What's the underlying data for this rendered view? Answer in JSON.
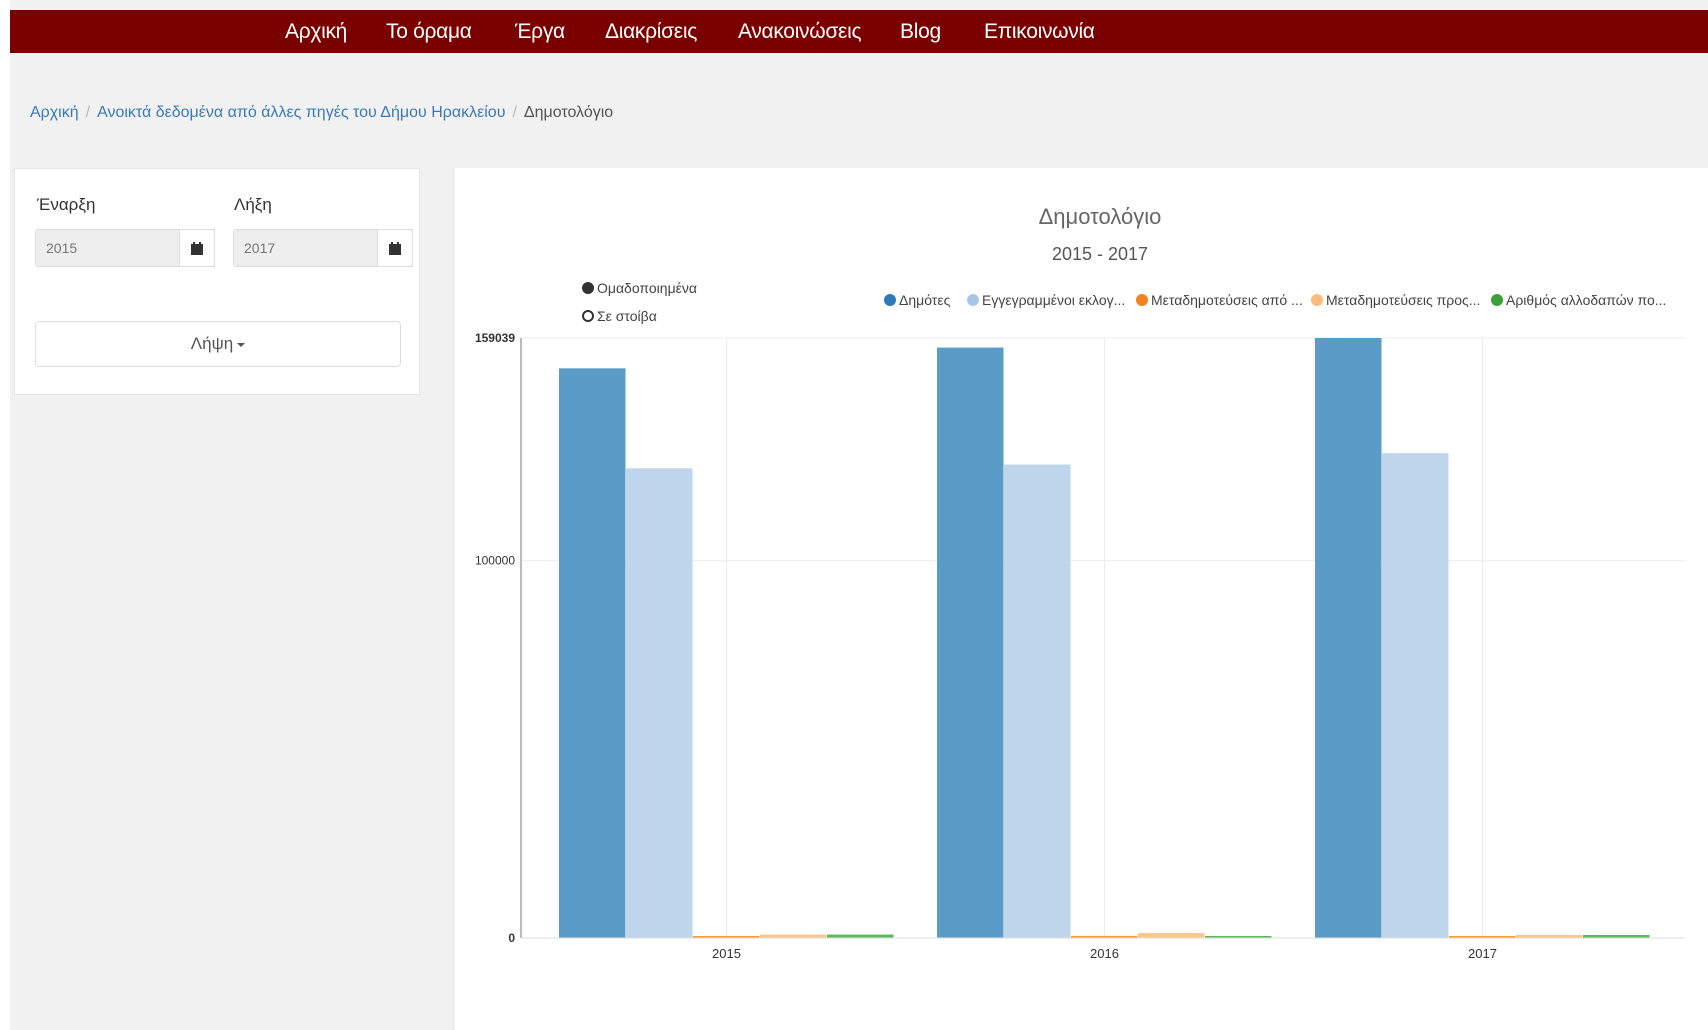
{
  "nav": {
    "items": [
      "Αρχική",
      "Το όραμα",
      "Έργα",
      "Διακρίσεις",
      "Ανακοινώσεις",
      "Blog",
      "Επικοινωνία"
    ],
    "background": "#7a0000"
  },
  "breadcrumb": {
    "home": "Αρχική",
    "parent": "Ανοικτά δεδομένα από άλλες πηγές του Δήμου Ηρακλείου",
    "current": "Δημοτολόγιο"
  },
  "filters": {
    "start_label": "Έναρξη",
    "start_value": "2015",
    "end_label": "Λήξη",
    "end_value": "2017",
    "calendar_icon": "calendar-icon",
    "download_label": "Λήψη"
  },
  "chart_controls": {
    "grouped_label": "Ομαδοποιημένα",
    "stacked_label": "Σε στοίβα",
    "selected": "grouped"
  },
  "chart_data": {
    "type": "bar",
    "title": "Δημοτολόγιο",
    "subtitle": "2015 - 2017",
    "categories": [
      "2015",
      "2016",
      "2017"
    ],
    "series": [
      {
        "name": "Δημότες",
        "color": "#5a9bc8",
        "legend_color": "#2f78b8",
        "values": [
          151000,
          156500,
          159039
        ]
      },
      {
        "name": "Εγγεγραμμένοι εκλογ...",
        "color": "#bfd5ec",
        "legend_color": "#aac6e6",
        "values": [
          124500,
          125500,
          128500
        ]
      },
      {
        "name": "Μεταδημοτεύσεις από ...",
        "color": "#ff9933",
        "legend_color": "#f58220",
        "values": [
          450,
          550,
          400
        ]
      },
      {
        "name": "Μεταδημοτεύσεις προς...",
        "color": "#ffc68a",
        "legend_color": "#fdbb7d",
        "values": [
          900,
          1300,
          800
        ]
      },
      {
        "name": "Αριθμός αλλοδαπών πο...",
        "color": "#5cb85c",
        "legend_color": "#3aa13a",
        "values": [
          900,
          500,
          800
        ]
      }
    ],
    "y_ticks": [
      "0",
      "100000",
      "159039"
    ],
    "ylim": [
      0,
      159039
    ],
    "legend_position": "top-right",
    "grid": true
  }
}
